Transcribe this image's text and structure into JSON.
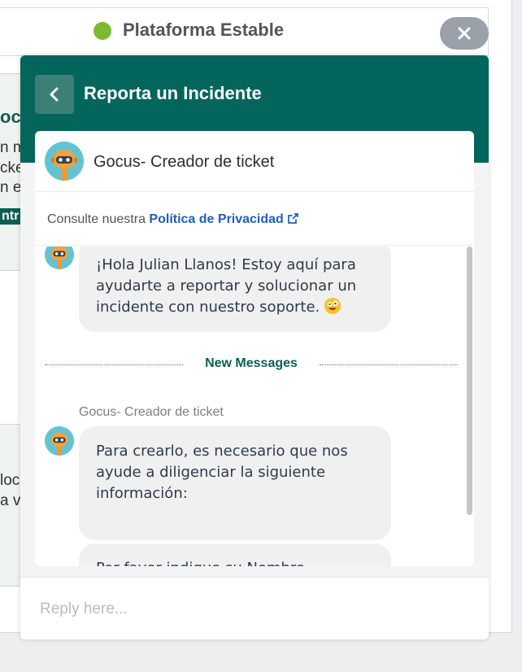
{
  "status": {
    "text": "Plataforma Estable",
    "dot_color": "#7cbb2f"
  },
  "background_fragments": {
    "card1_lines": [
      "oc",
      "n m",
      "cke",
      "n er"
    ],
    "card1_tag": "ntr",
    "card2_lines": [
      "loc",
      "a va"
    ]
  },
  "close_button": {
    "icon": "close-icon"
  },
  "widget": {
    "title": "Reporta un Incidente",
    "header_color": "#03655b",
    "back_icon": "chevron-left-icon",
    "agent_name": "Gocus- Creador de ticket",
    "privacy": {
      "prefix": "Consulte nuestra",
      "link": "Política de Privacidad",
      "link_icon": "external-link-icon"
    },
    "messages": [
      {
        "text": "¡Hola Julian Llanos! Estoy aquí para ayudarte a reportar y solucionar un incidente con nuestro soporte.",
        "emoji": "crazy-face-emoji"
      },
      {
        "text": "Para crearlo, es necesario que nos ayude a diligenciar la siguiente información:"
      },
      {
        "text": "Por favor indique su Nombre"
      }
    ],
    "new_messages_label": "New Messages",
    "sender_label": "Gocus- Creador de ticket",
    "reply_placeholder": "Reply here..."
  }
}
